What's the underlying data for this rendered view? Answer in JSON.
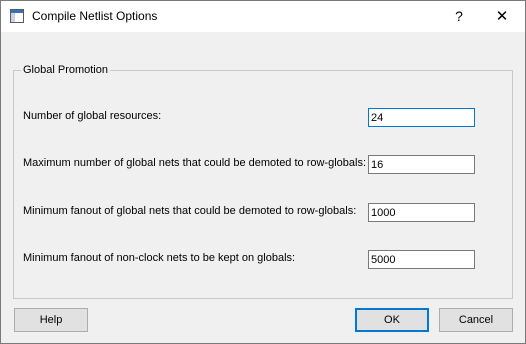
{
  "window": {
    "title": "Compile Netlist Options",
    "help_glyph": "?",
    "close_glyph": "✕",
    "icon": "window-app-icon"
  },
  "group": {
    "title": "Global Promotion",
    "fields": [
      {
        "label": "Number of global resources:",
        "value": "24"
      },
      {
        "label": "Maximum number of global nets that could be demoted to row-globals:",
        "value": "16"
      },
      {
        "label": "Minimum fanout of global nets that could be demoted to row-globals:",
        "value": "1000"
      },
      {
        "label": "Minimum fanout of non-clock nets to be kept on globals:",
        "value": "5000"
      }
    ]
  },
  "buttons": {
    "help": "Help",
    "ok": "OK",
    "cancel": "Cancel"
  },
  "colors": {
    "accent": "#0078d7",
    "dialog_bg": "#f0f0f0",
    "titlebar_bg": "#ffffff"
  }
}
